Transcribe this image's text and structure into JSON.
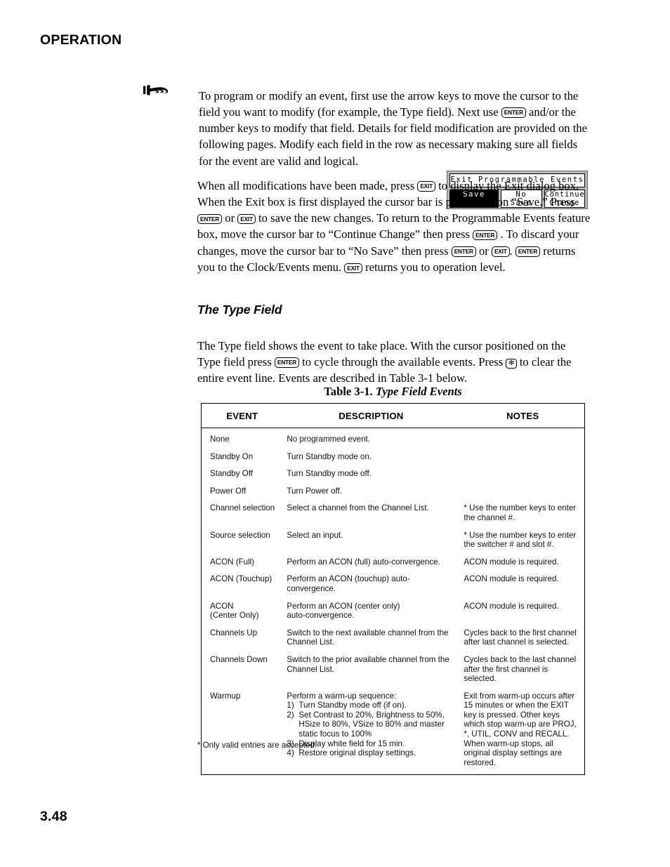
{
  "header": {
    "title": "OPERATION"
  },
  "note": {
    "icon": "pointing-hand-icon",
    "text_1": "To program or modify an event, first use the arrow keys to move the cursor to the field you want to modify (for example, the Type field). Next use ",
    "key_enter": "ENTER",
    "text_2": " and/or the number keys to modify that field. Details for field modification are provided on the following pages. Modify each field in the row as necessary making sure all fields for the event are valid and logical."
  },
  "exit_paragraph": {
    "t1": "When all modifications have been made, press ",
    "k1": "EXIT",
    "t2": " to display the Exit dialog box. When the Exit box is first displayed the cursor bar is positioned on “Save.” Press ",
    "k2": "ENTER",
    "t3": " or ",
    "k3": "EXIT",
    "t4": " to save the new changes. To return to the Programmable Events feature box, move the cursor bar to “Continue Change” then press ",
    "k4": "ENTER",
    "t5": " . To discard your changes, move the cursor bar to “No Save” then press ",
    "k5": "ENTER",
    "t6": " or ",
    "k6": "EXIT",
    "t7": ". ",
    "k7": "ENTER",
    "t8": " returns you to the Clock/Events menu. ",
    "k8": "EXIT",
    "t9": " returns you to operation level."
  },
  "exit_dialog": {
    "title": "Exit Programmable Events",
    "save_label": "Save",
    "no_save_line1": "No",
    "no_save_line2": "Save",
    "continue_line1": "Continue",
    "continue_line2": "Change",
    "selected": "Save",
    "highlight_bg": "#000000",
    "highlight_fg": "#ffffff",
    "frame_bg": "#b9b9b9"
  },
  "section": {
    "heading": "The Type Field",
    "p1": "The Type field shows the event to take place. With the cursor positioned on the Type field press ",
    "k1": "ENTER",
    "p2": " to cycle through the available events. Press ",
    "k2": "✻",
    "p3": " to clear the entire event line. Events are described in Table 3-1 below."
  },
  "table": {
    "caption_plain": "Table 3-1. ",
    "caption_italic": "Type Field Events",
    "headers": [
      "EVENT",
      "DESCRIPTION",
      "NOTES"
    ],
    "rows": [
      {
        "event": "None",
        "description": "No programmed event.",
        "notes": ""
      },
      {
        "event": "Standby On",
        "description": "Turn Standby mode on.",
        "notes": ""
      },
      {
        "event": "Standby Off",
        "description": "Turn Standby mode off.",
        "notes": ""
      },
      {
        "event": "Power Off",
        "description": "Turn Power off.",
        "notes": ""
      },
      {
        "event": "Channel selection",
        "description": "Select a channel from the Channel List.",
        "notes": "* Use the number keys to enter the channel #."
      },
      {
        "event": "Source selection",
        "description": "Select an input.",
        "notes": "* Use the number keys to enter the switcher # and slot #."
      },
      {
        "event": "ACON (Full)",
        "description": "Perform an ACON (full) auto-convergence.",
        "notes": "ACON module is required."
      },
      {
        "event": "ACON (Touchup)",
        "description": "Perform an ACON (touchup) auto-convergence.",
        "notes": "ACON module is required."
      },
      {
        "event": "ACON\n (Center Only)",
        "description": "Perform an ACON (center only)\nauto-convergence.",
        "notes": "ACON module is required."
      },
      {
        "event": "Channels Up",
        "description": "Switch to the next available channel from the Channel List.",
        "notes": "Cycles back to the first channel after last channel is selected."
      },
      {
        "event": "Channels Down",
        "description": "Switch to the prior available channel from the Channel List.",
        "notes": "Cycles back to the last channel after the first channel is selected."
      }
    ],
    "warmup_row": {
      "event": "Warmup",
      "description_intro": "Perform a warm-up sequence:",
      "description_steps": [
        {
          "num": "1)",
          "text": "Turn Standby mode off (if on)."
        },
        {
          "num": "2)",
          "text": "Set Contrast to 20%, Brightness to 50%, HSize to 80%, VSize to 80% and master static focus to 100%"
        },
        {
          "num": "3)",
          "text": "Display white field for 15 min."
        },
        {
          "num": "4)",
          "text": "Restore original display settings."
        }
      ],
      "notes": "Exit from warm-up occurs after 15 minutes or when the EXIT key is pressed. Other keys which stop warm-up are PROJ, *, UTIL, CONV and RECALL. When warm-up stops, all original display settings are restored."
    }
  },
  "footnote": "* Only valid entries are accepted.",
  "page_number": "3.48"
}
